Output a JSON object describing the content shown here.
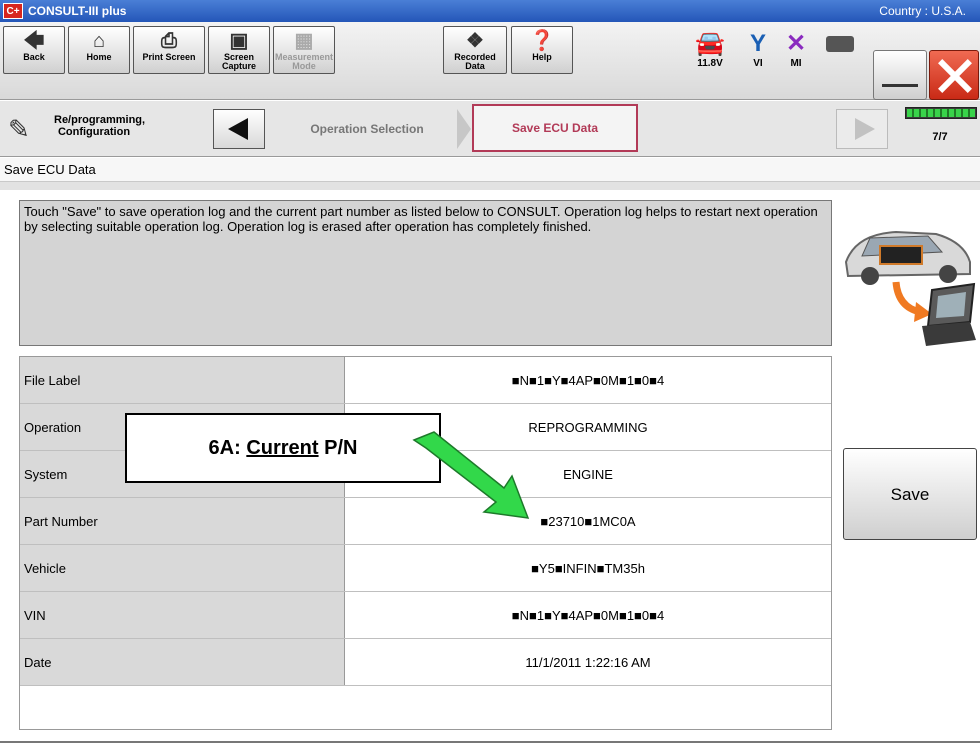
{
  "window": {
    "app_icon_text": "C+",
    "title": "CONSULT-III plus",
    "country": "Country : U.S.A."
  },
  "toolbar": {
    "buttons": [
      {
        "label": "Back",
        "icon": "back-arrow-icon"
      },
      {
        "label": "Home",
        "icon": "home-icon"
      },
      {
        "label": "Print Screen",
        "icon": "printer-icon"
      },
      {
        "label": "Screen Capture",
        "icon": "camera-icon"
      },
      {
        "label": "Measurement Mode",
        "icon": "measurement-icon",
        "disabled": true
      },
      {
        "label": "Recorded Data",
        "icon": "recorded-data-icon"
      },
      {
        "label": "Help",
        "icon": "help-icon"
      }
    ],
    "status": [
      {
        "label": "11.8V",
        "icon": "car-battery-icon"
      },
      {
        "label": "VI",
        "icon": "vi-antenna-icon"
      },
      {
        "label": "MI",
        "icon": "mi-x-icon"
      }
    ]
  },
  "breadcrumb": {
    "section_label": "Re/programming, Configuration",
    "step1": "Operation Selection",
    "step2": "Save ECU Data",
    "progress_text": "7/7",
    "progress_fraction": 1.0
  },
  "page": {
    "title": "Save ECU Data",
    "instruction": "Touch \"Save\" to save operation log and the current part number as listed below to CONSULT. Operation log helps to restart next operation by selecting suitable operation log. Operation log is erased after operation has completely finished."
  },
  "table": {
    "rows": [
      {
        "label": "File Label",
        "value": "■N■1■Y■4AP■0M■1■0■4"
      },
      {
        "label": "Operation",
        "value": "REPROGRAMMING"
      },
      {
        "label": "System",
        "value": "ENGINE"
      },
      {
        "label": "Part Number",
        "value": "■23710■1MC0A"
      },
      {
        "label": "Vehicle",
        "value": "■Y5■INFIN■TM35h"
      },
      {
        "label": "VIN",
        "value": "■N■1■Y■4AP■0M■1■0■4"
      },
      {
        "label": "Date",
        "value": "11/1/2011 1:22:16 AM"
      },
      {
        "label": "",
        "value": ""
      }
    ]
  },
  "save_button": "Save",
  "annotation": {
    "prefix": "6A: ",
    "underlined": "Current",
    "suffix": " P/N"
  },
  "colors": {
    "title_bar": "#2456b8",
    "active_step_border": "#b23a57",
    "close_button": "#d7261e",
    "callout_arrow": "#32d84a"
  }
}
